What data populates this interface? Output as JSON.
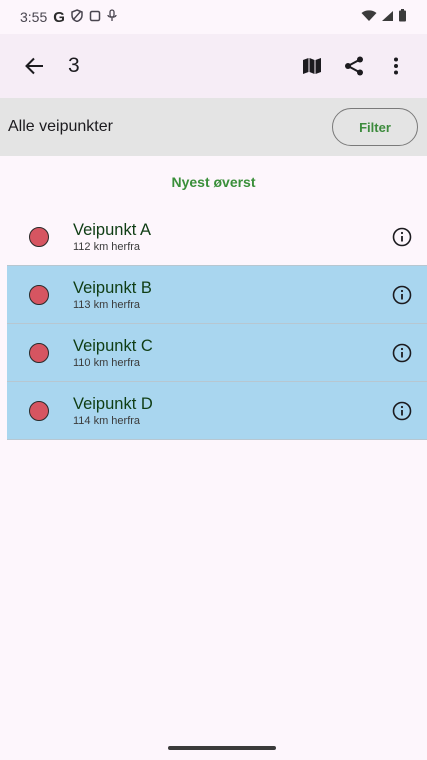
{
  "status_bar": {
    "time": "3:55",
    "g_label": "G"
  },
  "app_bar": {
    "title": "3"
  },
  "filter_bar": {
    "label": "Alle veipunkter",
    "button": "Filter"
  },
  "sort": {
    "label": "Nyest øverst"
  },
  "colors": {
    "dot": "#d65561",
    "selected_row": "#a9d6ef",
    "accent_green": "#3a8f3a"
  },
  "waypoints": [
    {
      "name": "Veipunkt A",
      "distance": "112 km herfra",
      "selected": false
    },
    {
      "name": "Veipunkt B",
      "distance": "113 km herfra",
      "selected": true
    },
    {
      "name": "Veipunkt C",
      "distance": "110 km herfra",
      "selected": true
    },
    {
      "name": "Veipunkt D",
      "distance": "114 km herfra",
      "selected": true
    }
  ]
}
